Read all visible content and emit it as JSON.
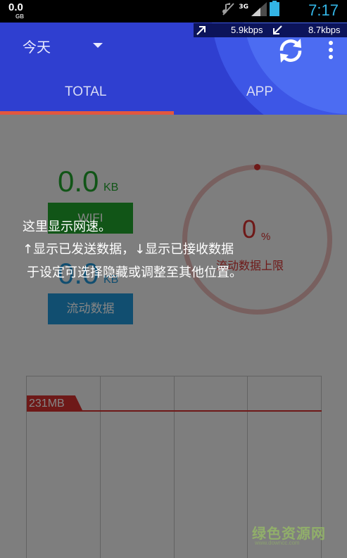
{
  "status_bar": {
    "speed": "0.0",
    "speed_unit": "GB",
    "network": "3G",
    "time": "7:17",
    "icons": [
      "mute-icon",
      "signal-icon",
      "battery-icon"
    ]
  },
  "speed_overlay": {
    "upload": "5.9kbps",
    "download": "8.7kbps"
  },
  "header": {
    "date_range": "今天",
    "tabs": [
      {
        "label": "TOTAL",
        "selected": true
      },
      {
        "label": "APP",
        "selected": false
      }
    ]
  },
  "summary": {
    "total_value": "0.0",
    "total_unit": "KB",
    "wifi_label": "WIFI",
    "mobile_value": "0.0",
    "mobile_unit": "KB",
    "mobile_label": "流动数据"
  },
  "quota": {
    "percent": "0",
    "percent_sign": "%",
    "label": "流动数据上限",
    "fraction": 0
  },
  "chart": {
    "limit_label": "231MB"
  },
  "tutorial": {
    "line1": "这里显示网速。",
    "line2": "↑显示已发送数据，↓显示已接收数据",
    "line3": "于设定可选择隐藏或调整至其他位置。"
  },
  "watermark": {
    "text": "绿色资源网",
    "url": "www.downcc.com"
  },
  "colors": {
    "primary": "#2f3fd0",
    "accent": "#e2573f",
    "wifi": "#22a32d",
    "mobile": "#2196d6",
    "quota": "#d3302f"
  }
}
